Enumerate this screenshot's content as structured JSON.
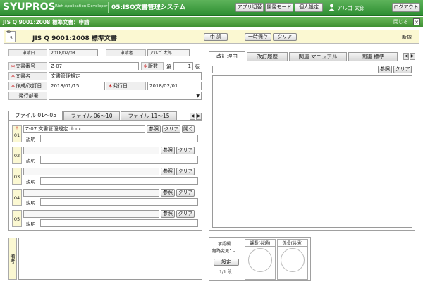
{
  "app": {
    "logo": "SYUPROS",
    "tagline": "Rich Application Developer",
    "system_name": "05:ISO文書管理システム",
    "nav_buttons": [
      "アプリ切替",
      "開発モード",
      "個人設定"
    ],
    "user_name": "アルゴ 太郎",
    "logout": "ログアウト"
  },
  "titlebar": {
    "title": "JIS Q 9001:2008 標準文書：申請",
    "close_label": "閉じる",
    "close_x": "✕"
  },
  "header": {
    "id_label": "ID",
    "id_value": "5",
    "doc_title": "JIS Q 9001:2008 標準文書",
    "btn_apply": "申 請",
    "btn_save": "一時保存",
    "btn_clear": "クリア",
    "mode": "新規"
  },
  "form": {
    "apply_date_label": "申請日",
    "apply_date": "2018/02/08",
    "applicant_label": "申請者",
    "applicant": "アルゴ 太郎",
    "doc_no_label": "文書番号",
    "doc_no": "Z-07",
    "version_label": "版数",
    "version_prefix": "第",
    "version_value": "1",
    "version_suffix": "版",
    "doc_name_label": "文書名",
    "doc_name": "文書管理規定",
    "created_label": "作成/改訂日",
    "created": "2018/01/15",
    "issued_label": "発行日",
    "issued": "2018/02/01",
    "dept_label": "発行部署",
    "dept_value": "",
    "required_mark": "＊"
  },
  "file_tabs": [
    "ファイル 01～05",
    "ファイル 06～10",
    "ファイル 11～15"
  ],
  "files": [
    {
      "no": "01",
      "name": "Z-07 文書管理規定.docx",
      "required": true
    },
    {
      "no": "02",
      "name": "",
      "required": false
    },
    {
      "no": "03",
      "name": "",
      "required": false
    },
    {
      "no": "04",
      "name": "",
      "required": false
    },
    {
      "no": "05",
      "name": "",
      "required": false
    }
  ],
  "file_labels": {
    "browse": "参照",
    "clear": "クリア",
    "open": "開く",
    "desc": "説明"
  },
  "remarks_label": "備考",
  "right_tabs": [
    "改訂理由",
    "改訂履歴",
    "関連 マニュアル",
    "関連 標準"
  ],
  "right_buttons": {
    "browse": "参照",
    "clear": "クリア"
  },
  "approval": {
    "col_label": "承認欄",
    "route_change": "経路変更：-",
    "setting": "設定",
    "step": "1/1 段",
    "roles": [
      "課長(共通)",
      "係長(共通)"
    ]
  },
  "colors": {
    "app_bar": "#2f8f33",
    "title_bar": "#4f9f3f",
    "header_bg": "#fbf8d2",
    "required": "#c00000"
  }
}
